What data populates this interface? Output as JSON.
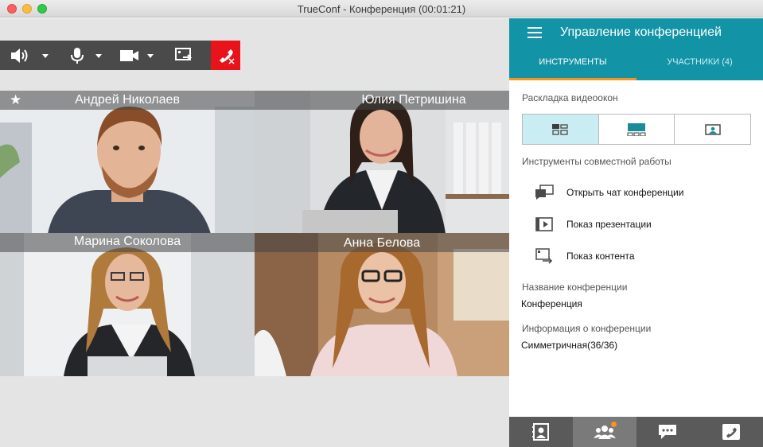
{
  "window": {
    "title": "TrueConf - Конференция (00:01:21)"
  },
  "toolbar": {
    "buttons": [
      {
        "icon": "speaker-icon",
        "dropdown": true
      },
      {
        "icon": "microphone-icon",
        "dropdown": true
      },
      {
        "icon": "camera-icon",
        "dropdown": true
      },
      {
        "icon": "share-screen-icon",
        "dropdown": false
      },
      {
        "icon": "hangup-icon",
        "dropdown": false
      }
    ],
    "hangup_color": "#e8141a"
  },
  "participants_video": [
    {
      "name": "Андрей Николаев",
      "starred": true
    },
    {
      "name": "Юлия Петришина",
      "starred": false
    },
    {
      "name": "Марина Соколова",
      "starred": false
    },
    {
      "name": "Анна Белова",
      "starred": false
    }
  ],
  "panel": {
    "title": "Управление конференцией",
    "accent": "#1393a6",
    "tab_underline_color": "#f7941d",
    "tabs": [
      {
        "label": "ИНСТРУМЕНТЫ",
        "active": true
      },
      {
        "label": "УЧАСТНИКИ (4)",
        "active": false
      }
    ],
    "layout_label": "Раскладка видеоокон",
    "layouts": [
      "grid-layout-icon",
      "speaker-layout-icon",
      "single-layout-icon"
    ],
    "tools_label": "Инструменты совместной работы",
    "tools": [
      {
        "icon": "chat-icon",
        "label": "Открыть чат конференции"
      },
      {
        "icon": "presentation-icon",
        "label": "Показ презентации"
      },
      {
        "icon": "content-share-icon",
        "label": "Показ контента"
      }
    ],
    "conf_name_label": "Название конференции",
    "conf_name_value": "Конференция",
    "conf_info_label": "Информация о конференции",
    "conf_info_value": "Симметричная(36/36)"
  },
  "bottom_bar": [
    {
      "icon": "contacts-icon",
      "active": false
    },
    {
      "icon": "participants-icon",
      "active": true,
      "badge": true
    },
    {
      "icon": "chat-icon",
      "active": false
    },
    {
      "icon": "call-icon",
      "active": false
    }
  ]
}
